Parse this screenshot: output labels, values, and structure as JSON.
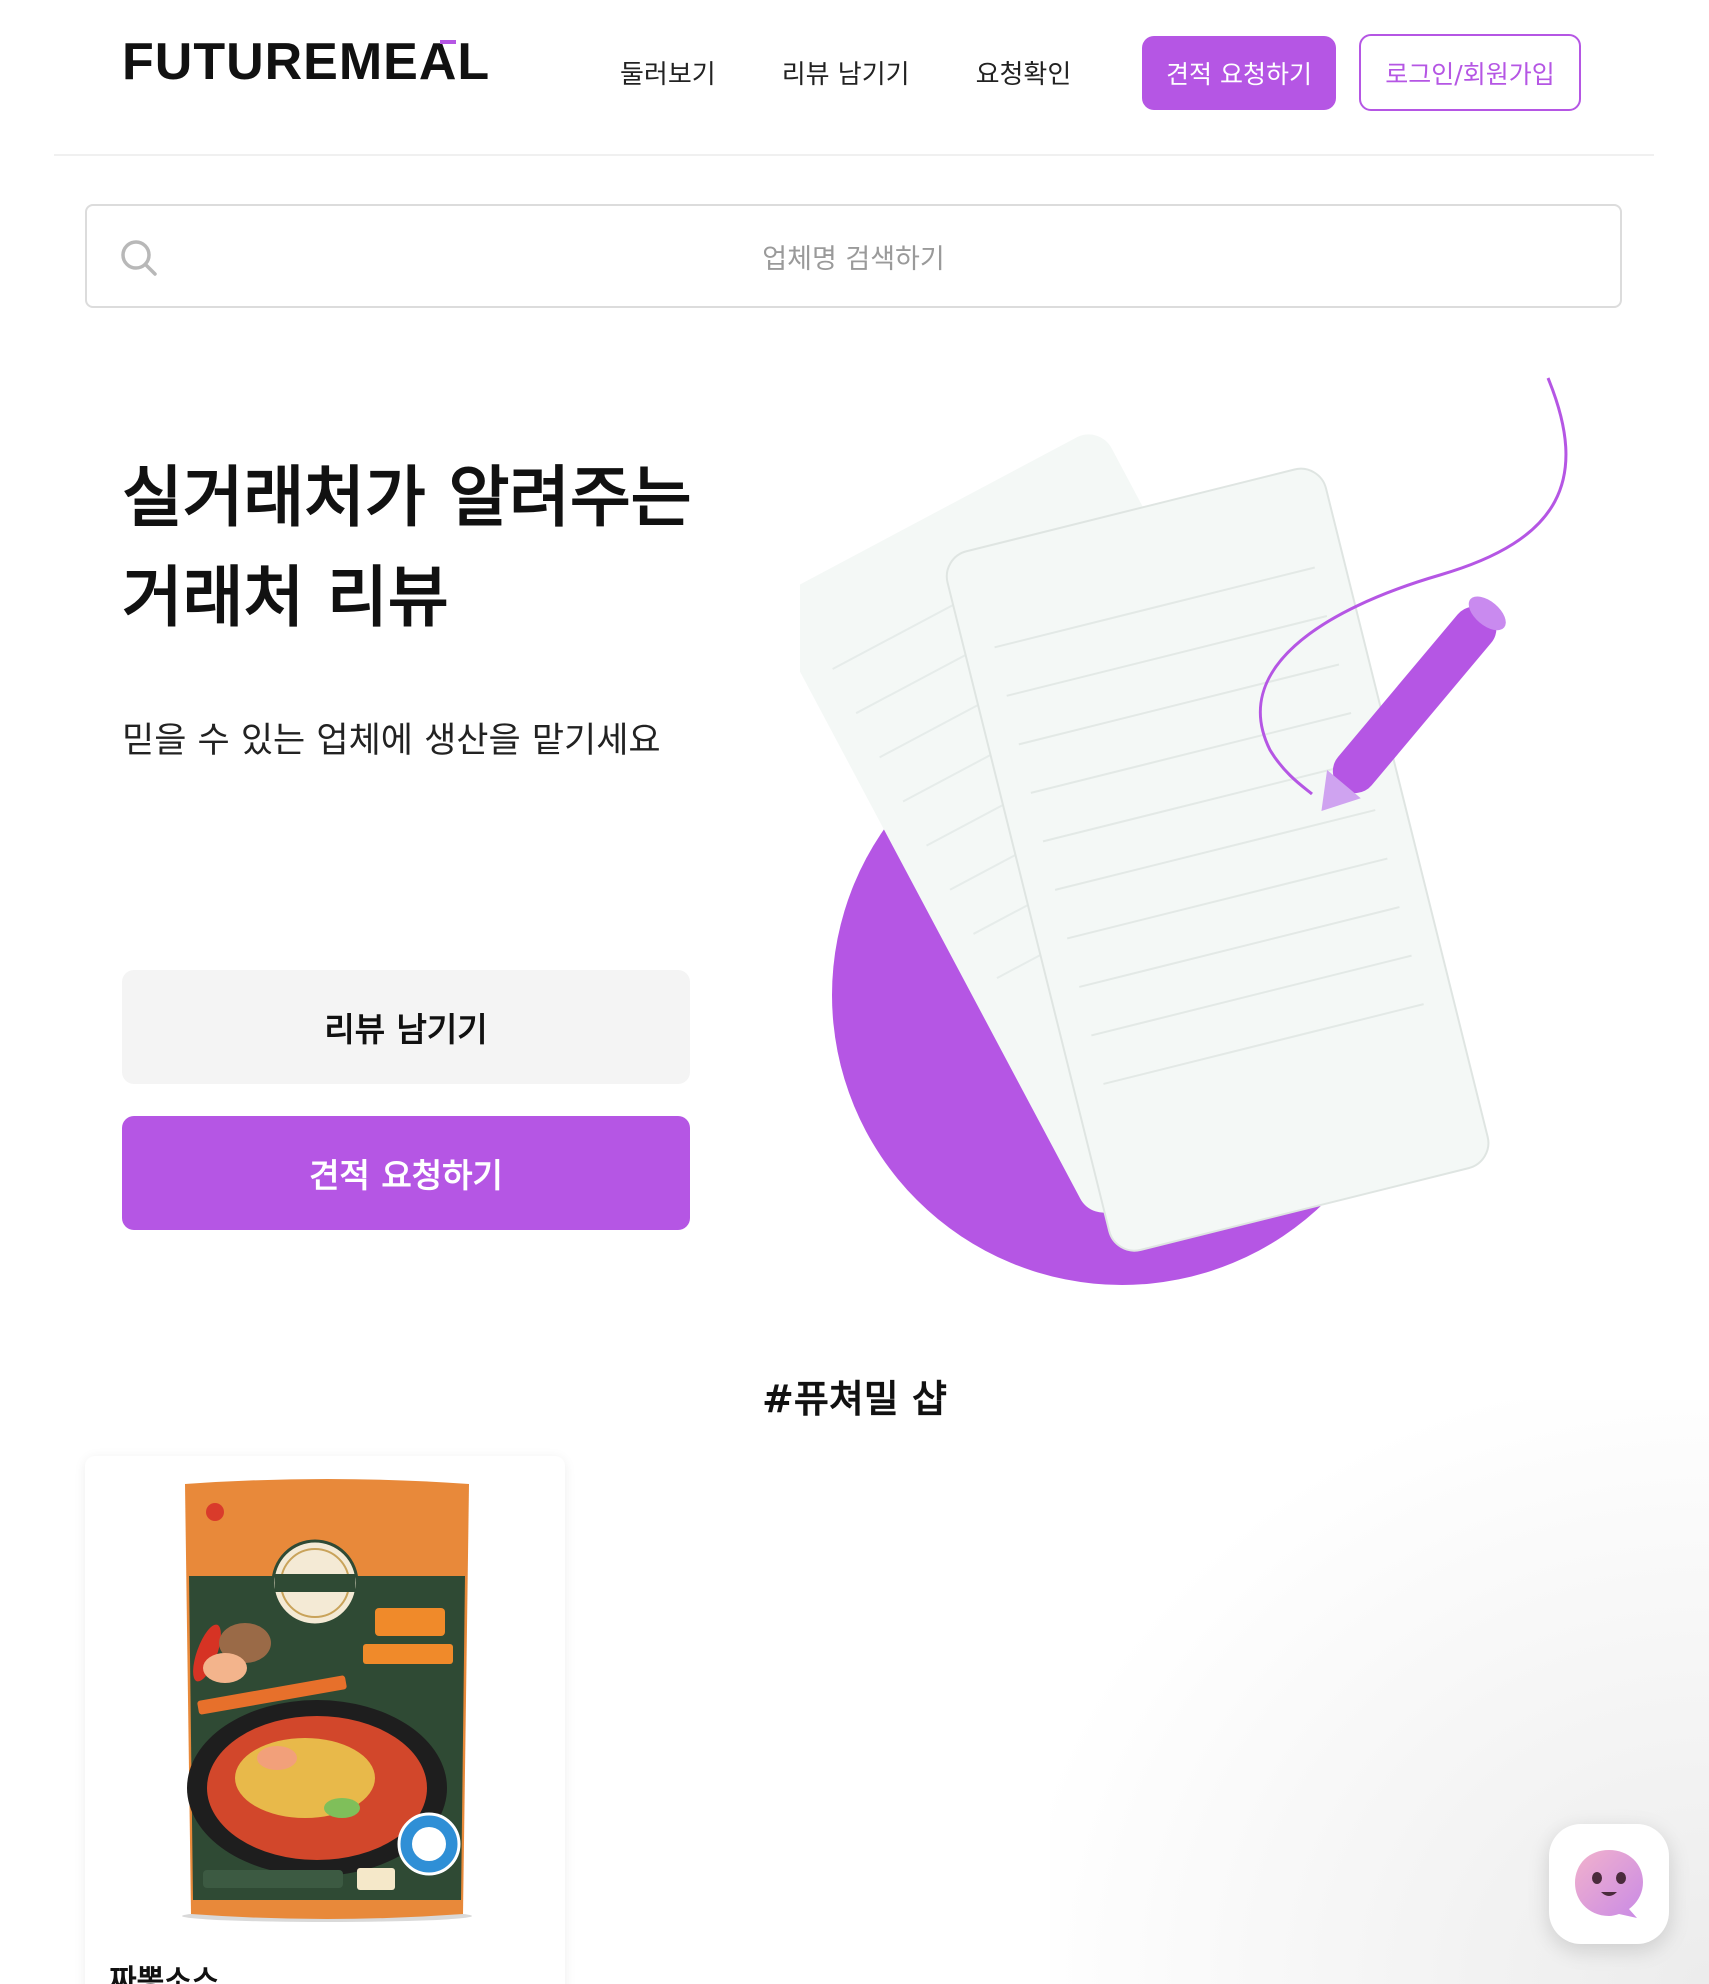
{
  "header": {
    "logo": "FUTUREMEAL",
    "nav": [
      "둘러보기",
      "리뷰 남기기",
      "요청확인"
    ],
    "cta_label": "견적 요청하기",
    "login_label": "로그인/회원가입"
  },
  "search": {
    "placeholder": "업체명 검색하기"
  },
  "hero": {
    "title_line1": "실거래처가 알려주는",
    "title_line2": "거래처 리뷰",
    "subtitle": "믿을 수 있는 업체에 생산을 맡기세요",
    "review_button": "리뷰 남기기",
    "quote_button": "견적 요청하기"
  },
  "shop": {
    "title": "#퓨쳐밀 샵",
    "products": [
      {
        "name": "짜뽕소스"
      }
    ]
  },
  "colors": {
    "accent": "#b556e4",
    "button_gray": "#f4f4f4",
    "text": "#111111"
  }
}
